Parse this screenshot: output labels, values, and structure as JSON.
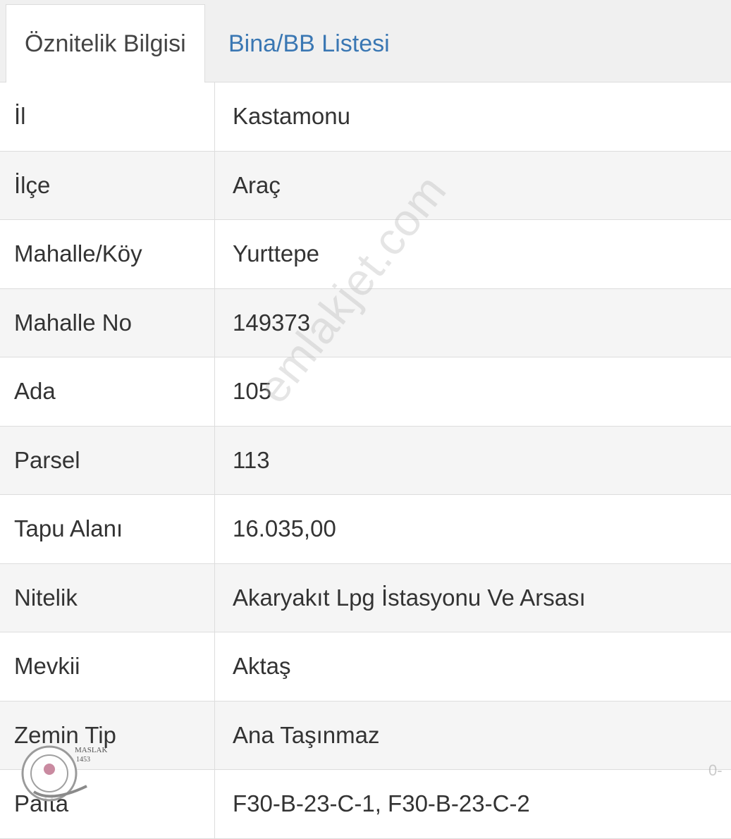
{
  "tabs": [
    {
      "label": "Öznitelik Bilgisi",
      "active": true
    },
    {
      "label": "Bina/BB Listesi",
      "active": false
    }
  ],
  "rows": [
    {
      "label": "İl",
      "value": "Kastamonu"
    },
    {
      "label": "İlçe",
      "value": "Araç"
    },
    {
      "label": "Mahalle/Köy",
      "value": "Yurttepe"
    },
    {
      "label": "Mahalle No",
      "value": "149373"
    },
    {
      "label": "Ada",
      "value": "105"
    },
    {
      "label": "Parsel",
      "value": "113"
    },
    {
      "label": "Tapu Alanı",
      "value": "16.035,00"
    },
    {
      "label": "Nitelik",
      "value": "Akaryakıt Lpg İstasyonu Ve Arsası"
    },
    {
      "label": "Mevkii",
      "value": "Aktaş"
    },
    {
      "label": "Zemin Tip",
      "value": "Ana Taşınmaz"
    },
    {
      "label": "Pafta",
      "value": "F30-B-23-C-1, F30-B-23-C-2"
    }
  ],
  "watermark": {
    "text": "emlakjet.com"
  },
  "stamp": {
    "line1": "MASLAK",
    "line2": "1453"
  },
  "colors": {
    "tab_link": "#3a77b3",
    "row_alt": "#f5f5f5",
    "border": "#dddddd"
  }
}
